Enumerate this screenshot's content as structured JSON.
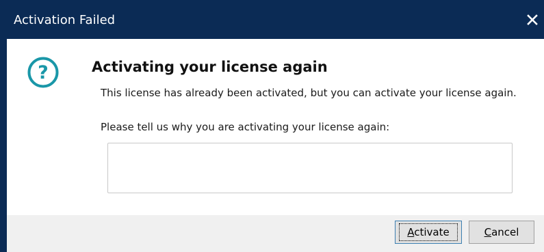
{
  "window": {
    "title": "Activation Failed",
    "close_icon": "close-icon"
  },
  "dialog": {
    "icon": "question-icon",
    "heading": "Activating your license again",
    "message": "This license has already been activated, but you can activate your license again.",
    "prompt": "Please tell us why you are activating your license again:",
    "reason_value": "",
    "reason_placeholder": ""
  },
  "buttons": {
    "activate": {
      "mnemonic": "A",
      "rest": "ctivate",
      "is_default": true
    },
    "cancel": {
      "mnemonic": "C",
      "rest": "ancel"
    }
  },
  "colors": {
    "titlebar": "#0b2b55",
    "icon_accent": "#1a97a8",
    "footer": "#f0f0f0",
    "default_button_border": "#3c7fb1"
  }
}
